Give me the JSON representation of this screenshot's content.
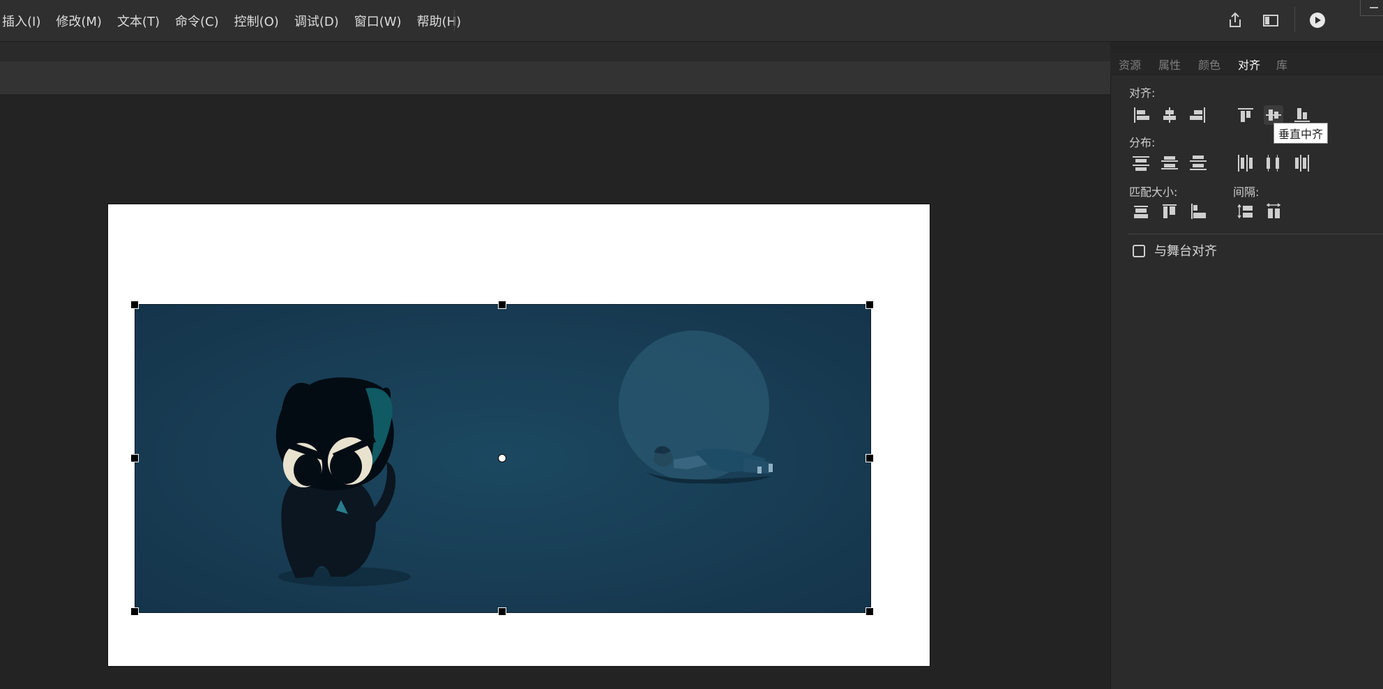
{
  "menubar": {
    "items": [
      {
        "label": "插入(I)"
      },
      {
        "label": "修改(M)"
      },
      {
        "label": "文本(T)"
      },
      {
        "label": "命令(C)"
      },
      {
        "label": "控制(O)"
      },
      {
        "label": "调试(D)"
      },
      {
        "label": "窗口(W)"
      },
      {
        "label": "帮助(H)"
      }
    ],
    "icons": [
      "share-icon",
      "layout-icon",
      "play-icon"
    ]
  },
  "panel": {
    "tabs": [
      {
        "label": "资源"
      },
      {
        "label": "属性"
      },
      {
        "label": "颜色"
      },
      {
        "label": "对齐"
      },
      {
        "label": "库"
      }
    ],
    "active_tab": "对齐",
    "align": {
      "label": "对齐:",
      "buttons": [
        "align-left-icon",
        "align-horizontal-center-icon",
        "align-right-icon",
        "align-top-icon",
        "align-vertical-center-icon",
        "align-bottom-icon"
      ]
    },
    "distribute": {
      "label": "分布:",
      "buttons": [
        "distribute-top-icon",
        "distribute-vertical-center-icon",
        "distribute-bottom-icon",
        "distribute-left-icon",
        "distribute-horizontal-center-icon",
        "distribute-right-icon"
      ]
    },
    "match_size": {
      "label": "匹配大小:",
      "buttons": [
        "match-width-icon",
        "match-height-icon",
        "match-width-height-icon"
      ]
    },
    "spacing": {
      "label": "间隔:",
      "buttons": [
        "space-vertical-icon",
        "space-horizontal-icon"
      ]
    },
    "tooltip": "垂直中齐",
    "align_to_stage": {
      "label": "与舞台对齐",
      "checked": false
    }
  },
  "colors": {
    "background": "#242424",
    "panel": "#2b2b2b",
    "stage": "#ffffff",
    "image": "#173a51",
    "accent_white": "#ffffff"
  }
}
